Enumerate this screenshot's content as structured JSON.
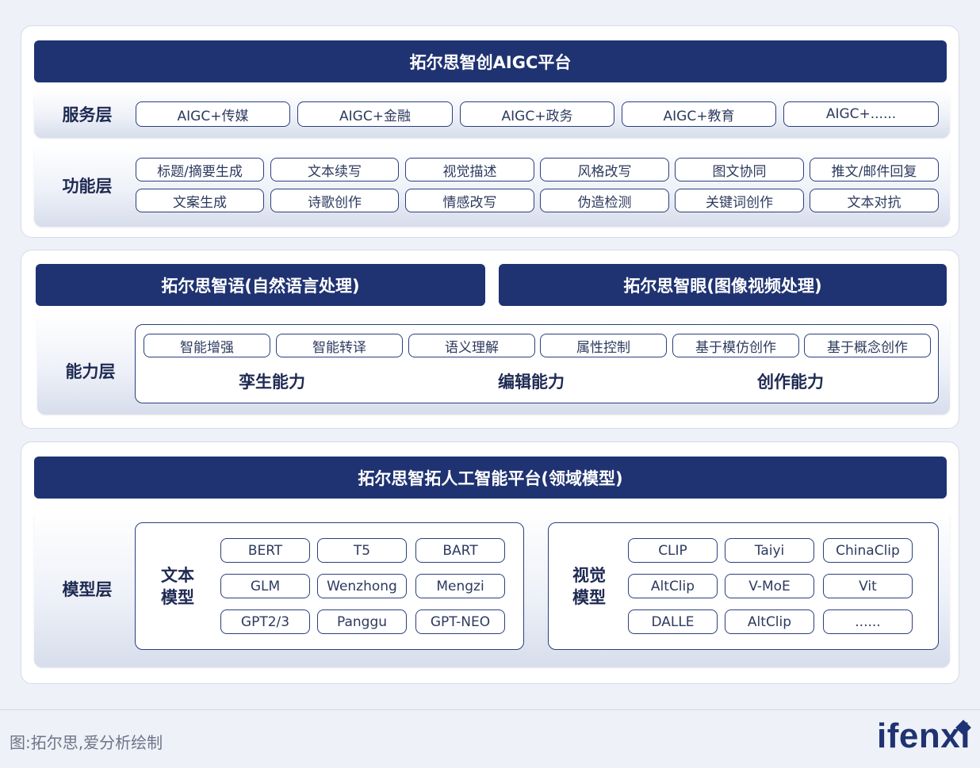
{
  "top_panel": {
    "title": "拓尔思智创AIGC平台",
    "service_layer": {
      "label": "服务层",
      "items": [
        "AIGC+传媒",
        "AIGC+金融",
        "AIGC+政务",
        "AIGC+教育",
        "AIGC+......"
      ]
    },
    "function_layer": {
      "label": "功能层",
      "row1": [
        "标题/摘要生成",
        "文本续写",
        "视觉描述",
        "风格改写",
        "图文协同",
        "推文/邮件回复"
      ],
      "row2": [
        "文案生成",
        "诗歌创作",
        "情感改写",
        "伪造检测",
        "关键词创作",
        "文本对抗"
      ]
    }
  },
  "middle_panel": {
    "left_title": "拓尔思智语(自然语言处理)",
    "right_title": "拓尔思智眼(图像视频处理)",
    "capability_layer": {
      "label": "能力层",
      "items": [
        "智能增强",
        "智能转译",
        "语义理解",
        "属性控制",
        "基于模仿创作",
        "基于概念创作"
      ],
      "groups": [
        "孪生能力",
        "编辑能力",
        "创作能力"
      ]
    }
  },
  "bottom_panel": {
    "title": "拓尔思智拓人工智能平台(领域模型)",
    "model_layer": {
      "label": "模型层",
      "text_models": {
        "label_line1": "文本",
        "label_line2": "模型",
        "items": [
          "BERT",
          "T5",
          "BART",
          "GLM",
          "Wenzhong",
          "Mengzi",
          "GPT2/3",
          "Panggu",
          "GPT-NEO"
        ]
      },
      "vision_models": {
        "label_line1": "视觉",
        "label_line2": "模型",
        "items": [
          "CLIP",
          "Taiyi",
          "ChinaClip",
          "AltClip",
          "V-MoE",
          "Vit",
          "DALLE",
          "AltClip",
          "......"
        ]
      }
    }
  },
  "footer": {
    "caption": "图:拓尔思,爱分析绘制",
    "logo": "ifenxi"
  },
  "colors": {
    "navy": "#1f3372",
    "text": "#1e2a52",
    "page_bg": "#eef1f7"
  }
}
